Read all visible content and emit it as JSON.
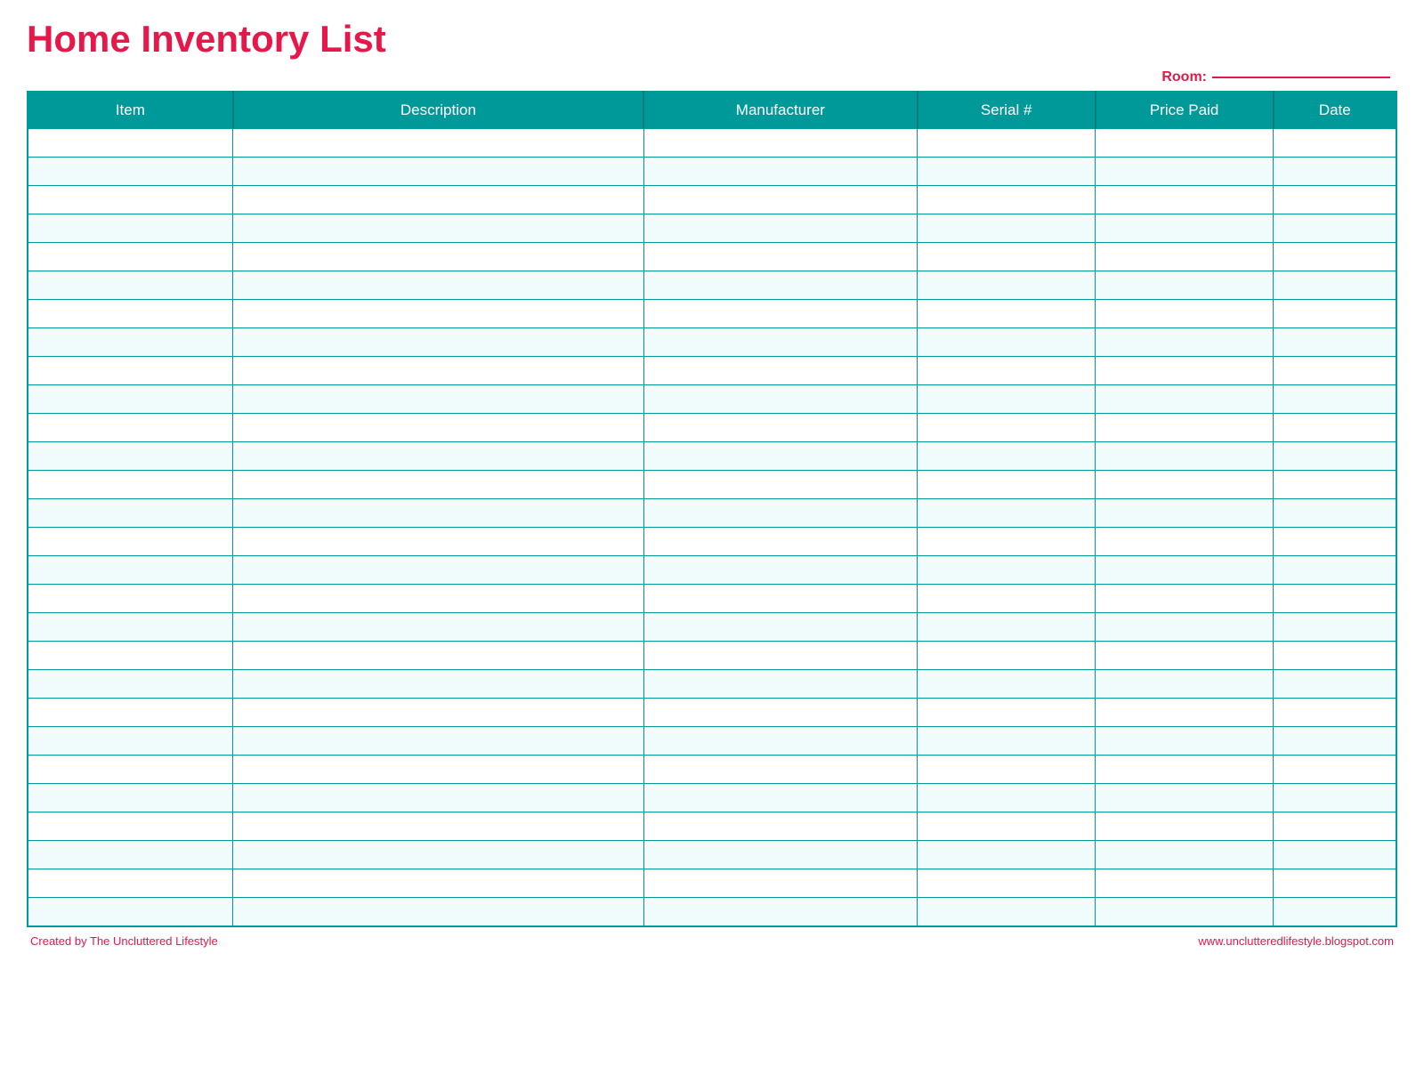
{
  "title": "Home Inventory List",
  "room": {
    "label": "Room:",
    "line": ""
  },
  "table": {
    "columns": [
      {
        "id": "item",
        "label": "Item"
      },
      {
        "id": "description",
        "label": "Description"
      },
      {
        "id": "manufacturer",
        "label": "Manufacturer"
      },
      {
        "id": "serial",
        "label": "Serial #"
      },
      {
        "id": "price",
        "label": "Price Paid"
      },
      {
        "id": "date",
        "label": "Date"
      }
    ],
    "row_count": 28
  },
  "footer": {
    "left": "Created by The Uncluttered Lifestyle",
    "right": "www.unclutteredlifestyle.blogspot.com"
  }
}
